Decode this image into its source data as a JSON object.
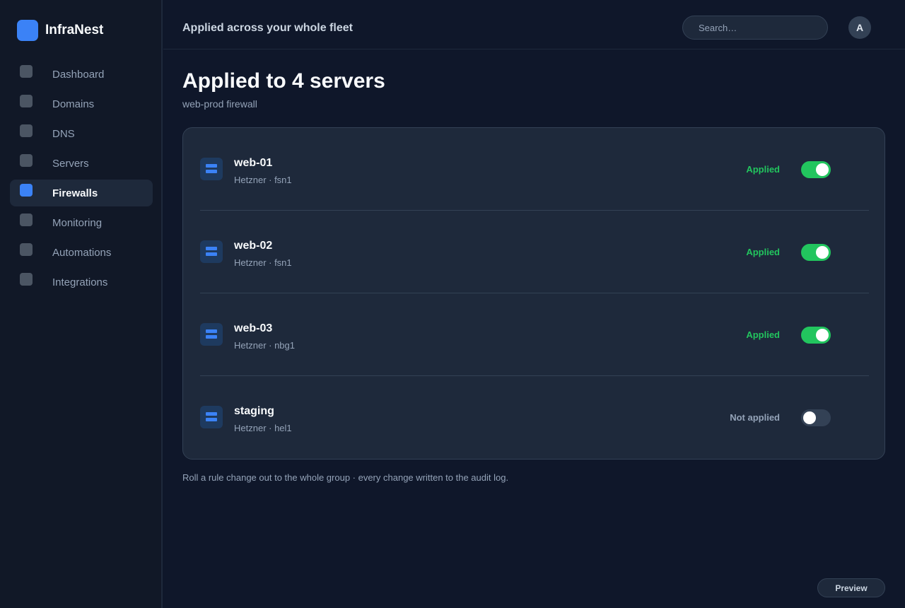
{
  "brand": {
    "name": "InfraNest",
    "accent": "#3b82f6"
  },
  "sidebar": {
    "items": [
      {
        "label": "Dashboard",
        "icon": "square-icon",
        "active": false
      },
      {
        "label": "Domains",
        "icon": "square-icon",
        "active": false
      },
      {
        "label": "DNS",
        "icon": "square-icon",
        "active": false
      },
      {
        "label": "Servers",
        "icon": "square-icon",
        "active": false
      },
      {
        "label": "Firewalls",
        "icon": "square-icon",
        "active": true
      },
      {
        "label": "Monitoring",
        "icon": "square-icon",
        "active": false
      },
      {
        "label": "Automations",
        "icon": "square-icon",
        "active": false
      },
      {
        "label": "Integrations",
        "icon": "square-icon",
        "active": false
      }
    ]
  },
  "header": {
    "title": "Applied across your whole fleet",
    "search_placeholder": "Search…",
    "avatar_initial": "A"
  },
  "main": {
    "title": "Applied to 4 servers",
    "subtitle": "web-prod firewall",
    "servers": [
      {
        "name": "web-01",
        "meta": "Hetzner · fsn1",
        "status": "Applied",
        "enabled": true
      },
      {
        "name": "web-02",
        "meta": "Hetzner · fsn1",
        "status": "Applied",
        "enabled": true
      },
      {
        "name": "web-03",
        "meta": "Hetzner · nbg1",
        "status": "Applied",
        "enabled": true
      },
      {
        "name": "staging",
        "meta": "Hetzner · hel1",
        "status": "Not applied",
        "enabled": false
      }
    ],
    "footnote": "Roll a rule change out to the whole group · every change written to the audit log.",
    "preview_label": "Preview"
  },
  "colors": {
    "status_on": "#22c55e",
    "status_off": "#94a3b8",
    "icon": "#3b82f6"
  }
}
